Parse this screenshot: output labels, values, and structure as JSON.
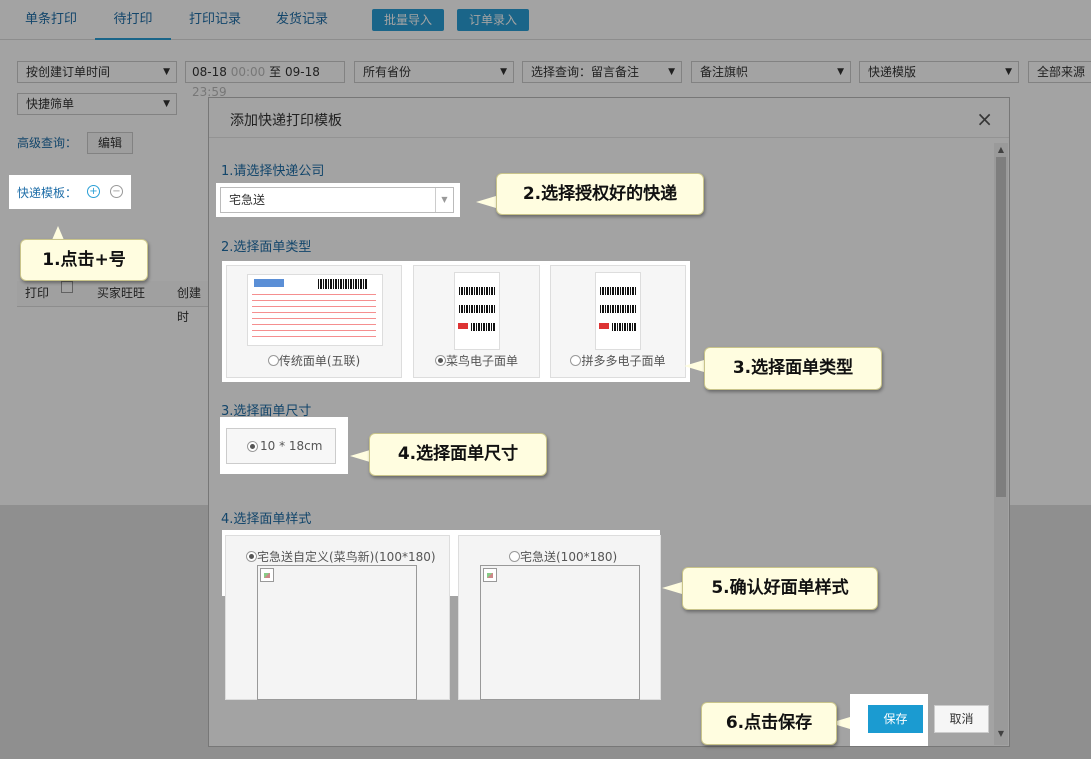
{
  "tabs": {
    "single_print": "单条打印",
    "pending_print": "待打印",
    "print_records": "打印记录",
    "ship_records": "发货记录",
    "batch_import": "批量导入",
    "order_entry": "订单录入"
  },
  "filters": {
    "order_time": "按创建订单时间",
    "date_start": "08-18",
    "time_start": "00:00",
    "date_sep": "至",
    "date_end": "09-18",
    "time_end": "23:59",
    "province": "所有省份",
    "query": "选择查询：留言备注",
    "flag": "备注旗帜",
    "express_template": "快递模版",
    "all_sources": "全部来源",
    "quick_filter": "快捷筛单"
  },
  "advanced": {
    "label": "高级查询：",
    "edit": "编辑"
  },
  "express_template_label": "快递模板：",
  "table_head": {
    "print": "打印",
    "buyer": "买家旺旺",
    "created": "创建时"
  },
  "modal": {
    "title": "添加快递打印模板",
    "close": "×",
    "step1_title": "1.请选择快递公司",
    "courier_value": "宅急送",
    "step2_title": "2.选择面单类型",
    "sheet_types": [
      {
        "label": "传统面单(五联)",
        "selected": false
      },
      {
        "label": "菜鸟电子面单",
        "selected": true
      },
      {
        "label": "拼多多电子面单",
        "selected": false
      }
    ],
    "step3_title": "3.选择面单尺寸",
    "size_option": "10 * 18cm",
    "step4_title": "4.选择面单样式",
    "styles": [
      {
        "label": "宅急送自定义(菜鸟新)(100*180)",
        "selected": true
      },
      {
        "label": "宅急送(100*180)",
        "selected": false
      }
    ],
    "save": "保存",
    "cancel": "取消"
  },
  "callouts": {
    "c1": "1.点击+号",
    "c2": "2.选择授权好的快递",
    "c3": "3.选择面单类型",
    "c4": "4.选择面单尺寸",
    "c5": "5.确认好面单样式",
    "c6": "6.点击保存"
  },
  "colors": {
    "accent": "#2a9fd6",
    "save_button": "#1b9bd1",
    "callout_bg": "#fffde0"
  }
}
